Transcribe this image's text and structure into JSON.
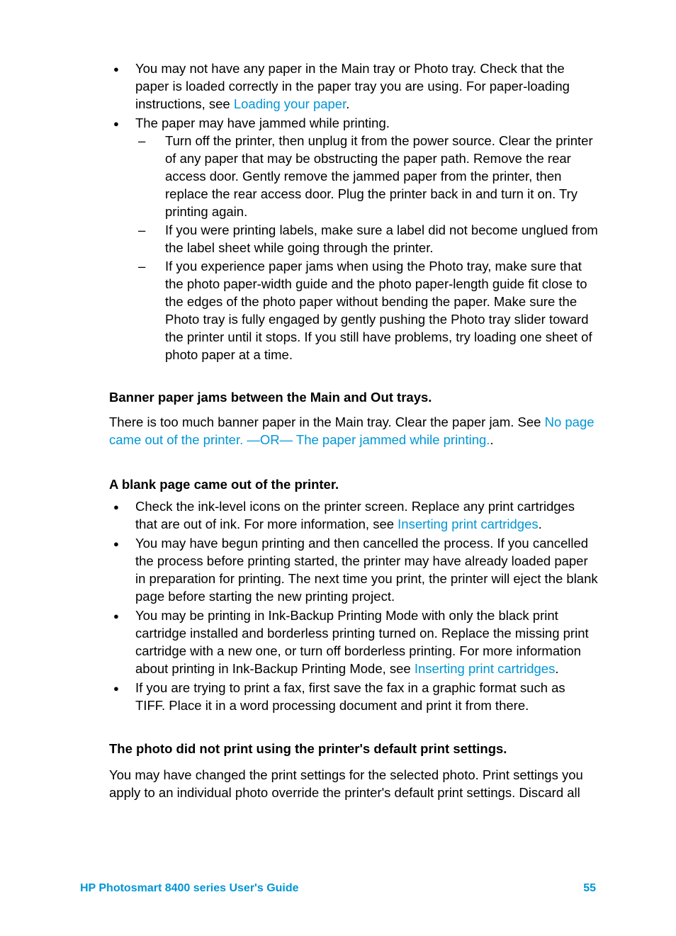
{
  "bullets1": {
    "item1_before": "You may not have any paper in the Main tray or Photo tray. Check that the paper is loaded correctly in the paper tray you are using. For paper-loading instructions, see ",
    "item1_link": "Loading your paper",
    "item1_after": ".",
    "item2": "The paper may have jammed while printing.",
    "sub1": "Turn off the printer, then unplug it from the power source. Clear the printer of any paper that may be obstructing the paper path. Remove the rear access door. Gently remove the jammed paper from the printer, then replace the rear access door. Plug the printer back in and turn it on. Try printing again.",
    "sub2": "If you were printing labels, make sure a label did not become unglued from the label sheet while going through the printer.",
    "sub3": "If you experience paper jams when using the Photo tray, make sure that the photo paper-width guide and the photo paper-length guide fit close to the edges of the photo paper without bending the paper. Make sure the Photo tray is fully engaged by gently pushing the Photo tray slider toward the printer until it stops. If you still have problems, try loading one sheet of photo paper at a time."
  },
  "sec2": {
    "heading": "Banner paper jams between the Main and Out trays.",
    "para_before": "There is too much banner paper in the Main tray. Clear the paper jam. See ",
    "link": "No page came out of the printer. —OR— The paper jammed while printing.",
    "para_after": "."
  },
  "sec3": {
    "heading": "A blank page came out of the printer.",
    "b1_before": "Check the ink-level icons on the printer screen. Replace any print cartridges that are out of ink. For more information, see ",
    "b1_link": "Inserting print cartridges",
    "b1_after": ".",
    "b2": "You may have begun printing and then cancelled the process. If you cancelled the process before printing started, the printer may have already loaded paper in preparation for printing. The next time you print, the printer will eject the blank page before starting the new printing project.",
    "b3_before": "You may be printing in Ink-Backup Printing Mode with only the black print cartridge installed and borderless printing turned on. Replace the missing print cartridge with a new one, or turn off borderless printing. For more information about printing in Ink-Backup Printing Mode, see ",
    "b3_link": "Inserting print cartridges",
    "b3_after": ".",
    "b4": "If you are trying to print a fax, first save the fax in a graphic format such as TIFF. Place it in a word processing document and print it from there."
  },
  "sec4": {
    "heading": "The photo did not print using the printer's default print settings.",
    "para": "You may have changed the print settings for the selected photo. Print settings you apply to an individual photo override the printer's default print settings. Discard all"
  },
  "footer": {
    "title": "HP Photosmart 8400 series User's Guide",
    "page": "55"
  }
}
